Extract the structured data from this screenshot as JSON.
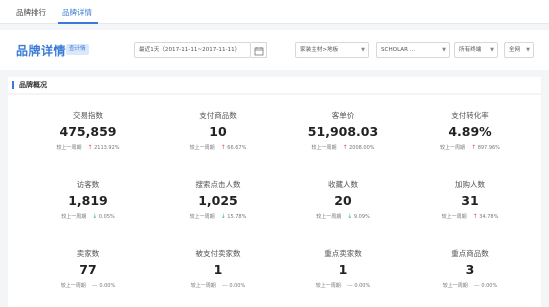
{
  "nav": {
    "tabs": [
      {
        "label": "品牌排行"
      },
      {
        "label": "品牌详情"
      }
    ]
  },
  "header": {
    "title": "品牌详情",
    "badge": "查计情",
    "date_range": "最近1天（2017-11-11~2017-11-11）",
    "category": "家装主材>地板",
    "brand": "SCHOLAR ...",
    "terminal": "所有终端",
    "region": "全网"
  },
  "section": {
    "title": "品牌概况"
  },
  "compare_label": "较上一周期",
  "metrics": [
    {
      "label": "交易指数",
      "value": "475,859",
      "change": "2113.92%",
      "trend": "up",
      "arrow": "↑"
    },
    {
      "label": "支付商品数",
      "value": "10",
      "change": "66.67%",
      "trend": "up",
      "arrow": "↑"
    },
    {
      "label": "客单价",
      "value": "51,908.03",
      "change": "2008.00%",
      "trend": "up",
      "arrow": "↑"
    },
    {
      "label": "支付转化率",
      "value": "4.89%",
      "change": "897.96%",
      "trend": "up",
      "arrow": "↑"
    },
    {
      "label": "访客数",
      "value": "1,819",
      "change": "0.05%",
      "trend": "down",
      "arrow": "↓"
    },
    {
      "label": "搜索点击人数",
      "value": "1,025",
      "change": "15.78%",
      "trend": "down",
      "arrow": "↓"
    },
    {
      "label": "收藏人数",
      "value": "20",
      "change": "9.09%",
      "trend": "down",
      "arrow": "↓"
    },
    {
      "label": "加购人数",
      "value": "31",
      "change": "34.78%",
      "trend": "up",
      "arrow": "↑"
    },
    {
      "label": "卖家数",
      "value": "77",
      "change": "0.00%",
      "trend": "flat",
      "arrow": "—"
    },
    {
      "label": "被支付卖家数",
      "value": "1",
      "change": "0.00%",
      "trend": "flat",
      "arrow": "—"
    },
    {
      "label": "重点卖家数",
      "value": "1",
      "change": "0.00%",
      "trend": "flat",
      "arrow": "—"
    },
    {
      "label": "重点商品数",
      "value": "3",
      "change": "0.00%",
      "trend": "flat",
      "arrow": "—"
    }
  ],
  "colors": {
    "accent": "#3a7ad6",
    "up": "#e5534b",
    "down": "#2fae5b",
    "flat": "#999999"
  },
  "icons": {
    "calendar": "calendar-icon",
    "dropdown": "chevron-down-icon"
  }
}
